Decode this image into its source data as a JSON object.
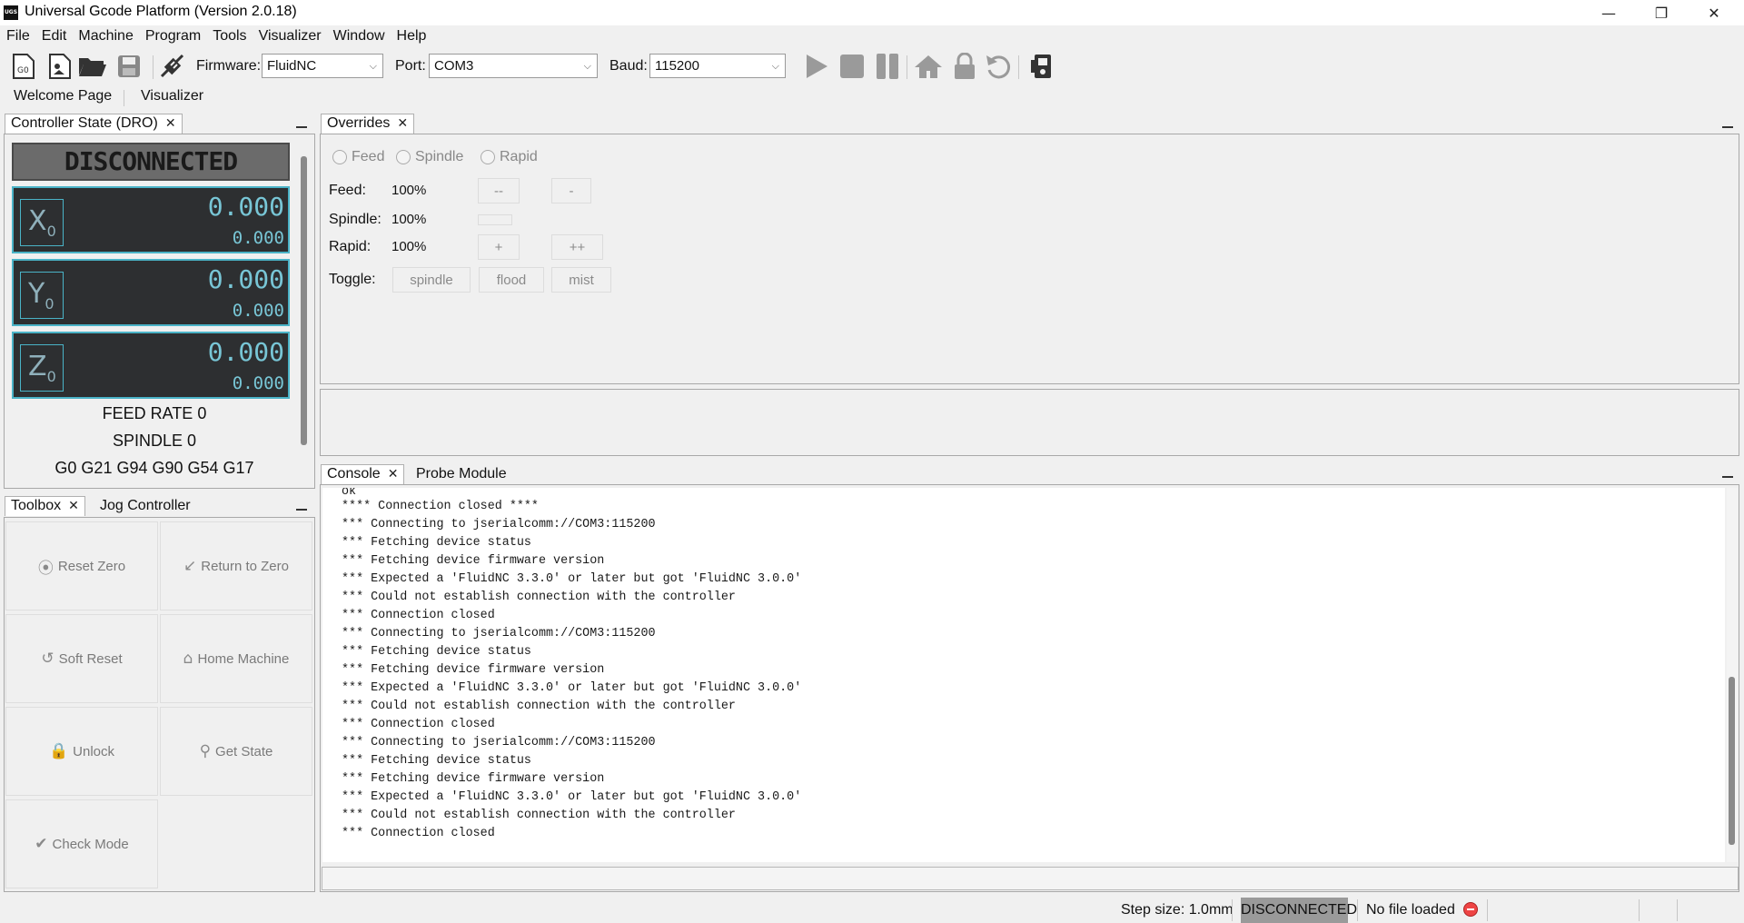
{
  "window": {
    "title": "Universal Gcode Platform (Version 2.0.18)",
    "app_icon_text": "UGS",
    "minimize_glyph": "—",
    "restore_glyph": "❐",
    "close_glyph": "✕"
  },
  "menu": [
    "File",
    "Edit",
    "Machine",
    "Program",
    "Tools",
    "Visualizer",
    "Window",
    "Help"
  ],
  "toolbar": {
    "firmware_label": "Firmware:",
    "firmware_value": "FluidNC",
    "port_label": "Port:",
    "port_value": "COM3",
    "baud_label": "Baud:",
    "baud_value": "115200",
    "icons": [
      "new-gcode-icon",
      "new-svg-icon",
      "open-folder-icon",
      "save-icon",
      "connect-icon",
      "play-icon",
      "stop-icon",
      "pause-icon",
      "home-icon",
      "lock-icon",
      "reset-icon",
      "machine-settings-icon"
    ]
  },
  "page_tabs": [
    "Welcome Page",
    "Visualizer"
  ],
  "dro": {
    "tab_label": "Controller State (DRO)",
    "status": "DISCONNECTED",
    "axes": [
      {
        "name": "X",
        "sub": "0",
        "work": "0.000",
        "machine": "0.000"
      },
      {
        "name": "Y",
        "sub": "0",
        "work": "0.000",
        "machine": "0.000"
      },
      {
        "name": "Z",
        "sub": "0",
        "work": "0.000",
        "machine": "0.000"
      }
    ],
    "feed_rate": "FEED RATE 0",
    "spindle": "SPINDLE 0",
    "gcode_state": "G0 G21 G94 G90 G54 G17"
  },
  "toolbox": {
    "tab_label": "Toolbox",
    "jog_tab_label": "Jog Controller",
    "buttons": [
      {
        "label": "Reset Zero",
        "icon": "reset-zero-icon",
        "glyph": "⦿"
      },
      {
        "label": "Return to Zero",
        "icon": "return-to-zero-icon",
        "glyph": "↙"
      },
      {
        "label": "Soft Reset",
        "icon": "soft-reset-icon",
        "glyph": "↺"
      },
      {
        "label": "Home Machine",
        "icon": "home-icon",
        "glyph": "⌂"
      },
      {
        "label": "Unlock",
        "icon": "lock-icon",
        "glyph": "🔒"
      },
      {
        "label": "Get State",
        "icon": "search-icon",
        "glyph": "⚲"
      },
      {
        "label": "Check Mode",
        "icon": "check-icon",
        "glyph": "✔"
      }
    ]
  },
  "overrides": {
    "tab_label": "Overrides",
    "radios": [
      "Feed",
      "Spindle",
      "Rapid"
    ],
    "rows": [
      {
        "label": "Feed:",
        "value": "100%",
        "buttons": [
          "--",
          "-"
        ]
      },
      {
        "label": "Spindle:",
        "value": "100%",
        "buttons": [
          ""
        ]
      },
      {
        "label": "Rapid:",
        "value": "100%",
        "buttons": [
          "+",
          "++"
        ]
      }
    ],
    "toggle_label": "Toggle:",
    "toggles": [
      "spindle",
      "flood",
      "mist"
    ]
  },
  "console": {
    "tab_label": "Console",
    "probe_tab_label": "Probe Module",
    "lines": [
      "ok",
      "**** Connection closed ****",
      "*** Connecting to jserialcomm://COM3:115200",
      "*** Fetching device status",
      "*** Fetching device firmware version",
      "*** Expected a 'FluidNC 3.3.0' or later but got 'FluidNC 3.0.0'",
      "*** Could not establish connection with the controller",
      "*** Connection closed",
      "*** Connecting to jserialcomm://COM3:115200",
      "*** Fetching device status",
      "*** Fetching device firmware version",
      "*** Expected a 'FluidNC 3.3.0' or later but got 'FluidNC 3.0.0'",
      "*** Could not establish connection with the controller",
      "*** Connection closed",
      "*** Connecting to jserialcomm://COM3:115200",
      "*** Fetching device status",
      "*** Fetching device firmware version",
      "*** Expected a 'FluidNC 3.3.0' or later but got 'FluidNC 3.0.0'",
      "*** Could not establish connection with the controller",
      "*** Connection closed"
    ]
  },
  "statusbar": {
    "step_size": "Step size: 1.0mm",
    "connection": "DISCONNECTED",
    "file": "No file loaded"
  },
  "colors": {
    "dro_background": "#2d2f31",
    "dro_accent": "#4ab3c7",
    "status_stop": "#e44444"
  }
}
